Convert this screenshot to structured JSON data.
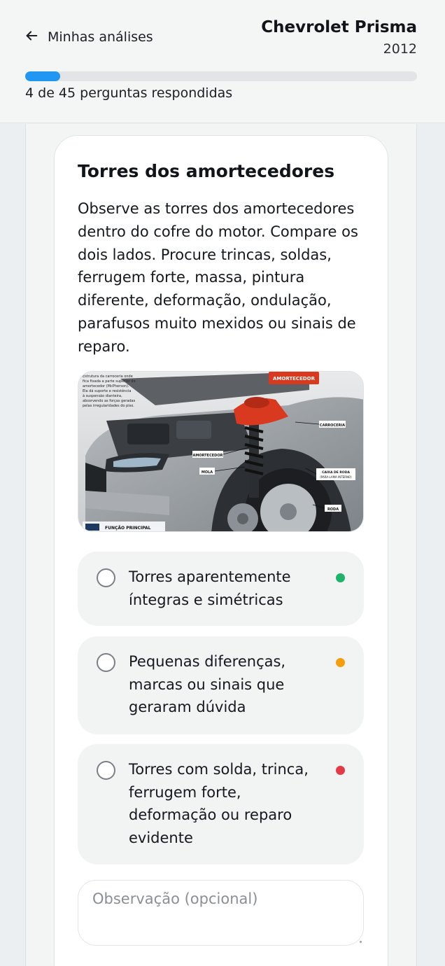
{
  "header": {
    "back_label": "Minhas análises",
    "car_model": "Chevrolet Prisma",
    "car_year": "2012",
    "progress": {
      "answered": 4,
      "total": 45,
      "text": "4 de 45 perguntas respondidas"
    }
  },
  "question": {
    "title": "Torres dos amortecedores",
    "description": "Observe as torres dos amortecedores dentro do cofre do motor. Compare os dois lados. Procure trincas, soldas, ferrugem forte, massa, pintura diferente, deformação, ondulação, parafusos muito mexidos ou sinais de reparo.",
    "image": {
      "callout": "AMORTECEDOR",
      "labels": [
        "CARROCERIA",
        "AMORTECEDOR",
        "MOLA",
        "CAIXA DE RODA",
        "(PARA-LAMA INTERNO)",
        "RODA"
      ],
      "notes": [
        "Estrutura da carroceria onde",
        "fica fixada a parte superior do",
        "amortecedor (McPherson).",
        "Ela dá suporte e resistência",
        "à suspensão dianteira,",
        "absorvendo as forças geradas",
        "pelas irregularidades do piso."
      ],
      "footer": "FUNÇÃO PRINCIPAL"
    }
  },
  "options": [
    {
      "label": "Torres aparentemente íntegras e simétricas",
      "color": "#1db36b"
    },
    {
      "label": "Pequenas diferenças, marcas ou sinais que geraram dúvida",
      "color": "#f59e0b"
    },
    {
      "label": "Torres com solda, trinca, ferrugem forte, deformação ou reparo evidente",
      "color": "#e53945"
    }
  ],
  "observation": {
    "placeholder": "Observação (opcional)",
    "value": ""
  },
  "icons": {
    "back": "arrow-left-icon"
  },
  "colors": {
    "accent": "#2196f3",
    "ok": "#1db36b",
    "warn": "#f59e0b",
    "bad": "#e53945"
  }
}
